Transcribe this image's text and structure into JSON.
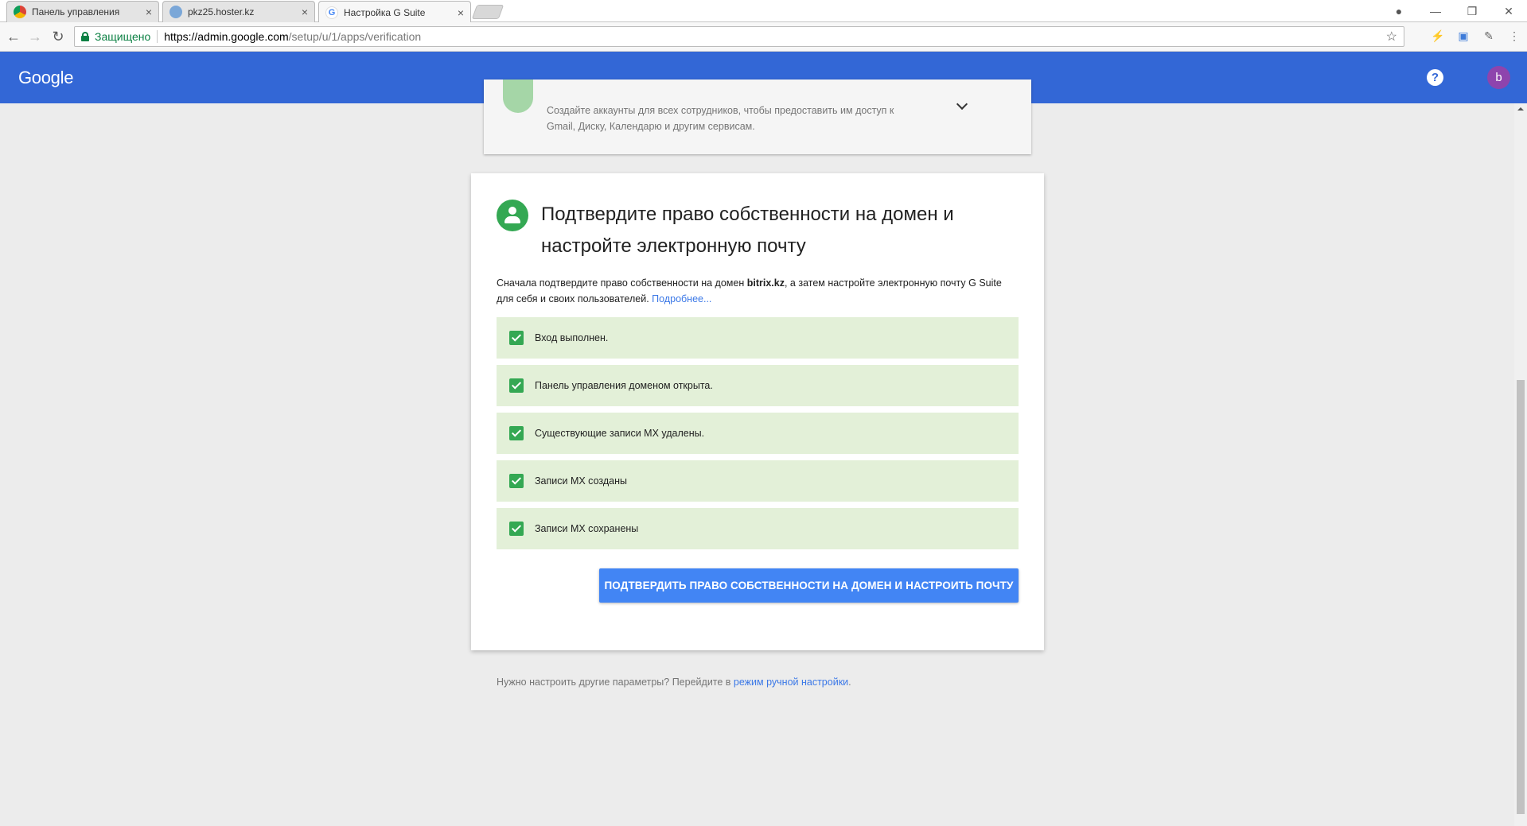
{
  "browser": {
    "tabs": [
      {
        "label": "Панель управления",
        "active": false
      },
      {
        "label": "pkz25.hoster.kz",
        "active": false
      },
      {
        "label": "Настройка G Suite",
        "active": true
      }
    ],
    "tab_close_glyph": "×",
    "window_controls": [
      "—",
      "❐",
      "✕"
    ],
    "address_bar": {
      "secure_label": "Защищено",
      "url_host": "https://admin.google.com",
      "url_path": "/setup/u/1/apps/verification"
    },
    "colors": {
      "secure": "#0b8043"
    }
  },
  "header": {
    "logo": "Google",
    "help_glyph": "?",
    "avatar_letter": "b",
    "colors": {
      "bar": "#3367d6",
      "avatar": "#8e44ad"
    }
  },
  "prev_step": {
    "description": "Создайте аккаунты для всех сотрудников, чтобы предоставить им доступ к Gmail, Диску, Календарю и другим сервисам."
  },
  "verify_card": {
    "title": "Подтвердите право собственности на домен и настройте электронную почту",
    "desc_before": "Сначала подтвердите право собственности на домен ",
    "domain": "bitrix.kz",
    "desc_after": ", а затем настройте электронную почту G Suite для себя и своих пользователей. ",
    "learn_more": "Подробнее...",
    "steps": [
      {
        "label": "Вход выполнен.",
        "done": true
      },
      {
        "label": "Панель управления доменом открыта.",
        "done": true
      },
      {
        "label": "Существующие записи MX удалены.",
        "done": true
      },
      {
        "label": "Записи MX созданы",
        "done": true
      },
      {
        "label": "Записи MX сохранены",
        "done": true
      }
    ],
    "button_label": "Подтвердить право собственности на домен и настроить почту",
    "colors": {
      "step_bg": "#e3f0d8",
      "check": "#34a853",
      "button": "#4285f4"
    }
  },
  "footer": {
    "text": "Нужно настроить другие параметры? Перейдите в ",
    "link": "режим ручной настройки",
    "end": "."
  }
}
